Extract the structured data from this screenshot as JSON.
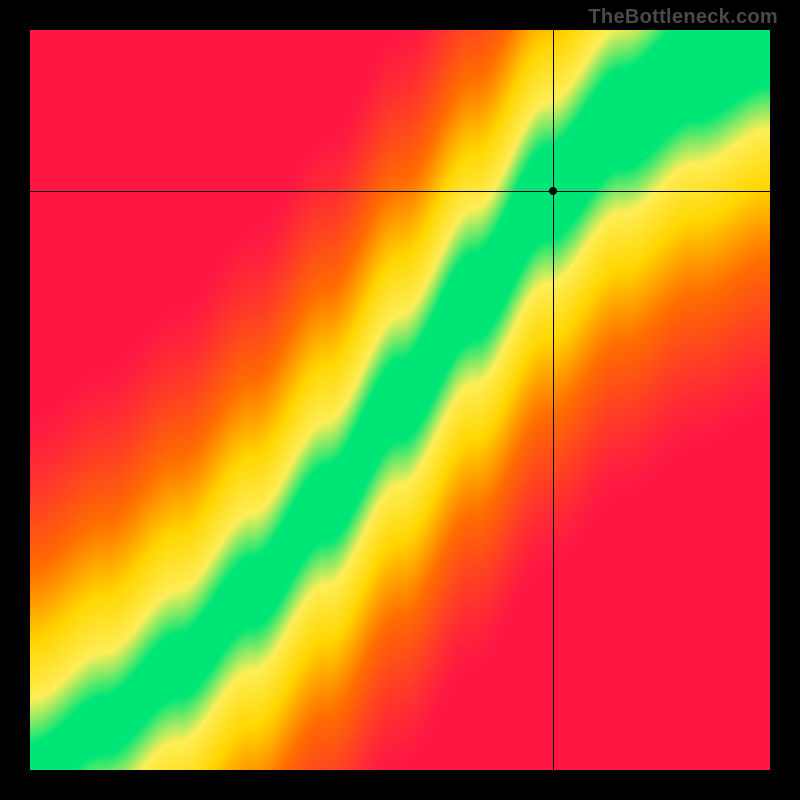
{
  "watermark": "TheBottleneck.com",
  "chart_data": {
    "type": "heatmap",
    "title": "",
    "xlabel": "",
    "ylabel": "",
    "x_range": [
      0,
      1
    ],
    "y_range": [
      0,
      1
    ],
    "crosshair": {
      "x": 0.707,
      "y": 0.783
    },
    "marker": {
      "x": 0.707,
      "y": 0.783
    },
    "optimal_curve_note": "Green optimal band follows a superlinear curve from bottom-left to top-right; colors blend red→orange→yellow→green→yellow→orange→red away from the band.",
    "optimal_curve_samples": [
      {
        "x": 0.0,
        "y": 0.0
      },
      {
        "x": 0.1,
        "y": 0.06
      },
      {
        "x": 0.2,
        "y": 0.14
      },
      {
        "x": 0.3,
        "y": 0.24
      },
      {
        "x": 0.4,
        "y": 0.36
      },
      {
        "x": 0.5,
        "y": 0.5
      },
      {
        "x": 0.6,
        "y": 0.64
      },
      {
        "x": 0.7,
        "y": 0.78
      },
      {
        "x": 0.8,
        "y": 0.88
      },
      {
        "x": 0.9,
        "y": 0.95
      },
      {
        "x": 1.0,
        "y": 1.0
      }
    ],
    "color_stops": [
      {
        "t": 0.0,
        "color": "#ff1744"
      },
      {
        "t": 0.35,
        "color": "#ff6d00"
      },
      {
        "t": 0.6,
        "color": "#ffd600"
      },
      {
        "t": 0.82,
        "color": "#ffee58"
      },
      {
        "t": 1.0,
        "color": "#00e676"
      }
    ]
  }
}
